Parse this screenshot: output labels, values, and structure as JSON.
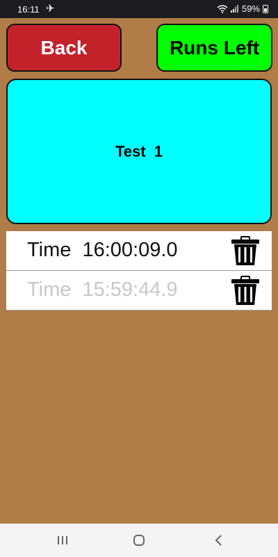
{
  "status_bar": {
    "time": "16:11",
    "battery": "59%",
    "icons": [
      "airplane-icon",
      "wifi-icon",
      "signal-icon",
      "battery-icon"
    ]
  },
  "header": {
    "back_label": "Back",
    "runs_left_label": "Runs Left"
  },
  "panel": {
    "title": "Test  1"
  },
  "times": [
    {
      "label": "Time  16:00:09.0",
      "faded": false
    },
    {
      "label": "Time  15:59:44.9",
      "faded": true
    }
  ],
  "colors": {
    "background": "#b07d48",
    "back_button": "#c4222b",
    "runs_left_button": "#00ff00",
    "panel": "#00ffff"
  },
  "nav_bar": {
    "icons": [
      "recent-apps-icon",
      "home-icon",
      "back-nav-icon"
    ]
  }
}
